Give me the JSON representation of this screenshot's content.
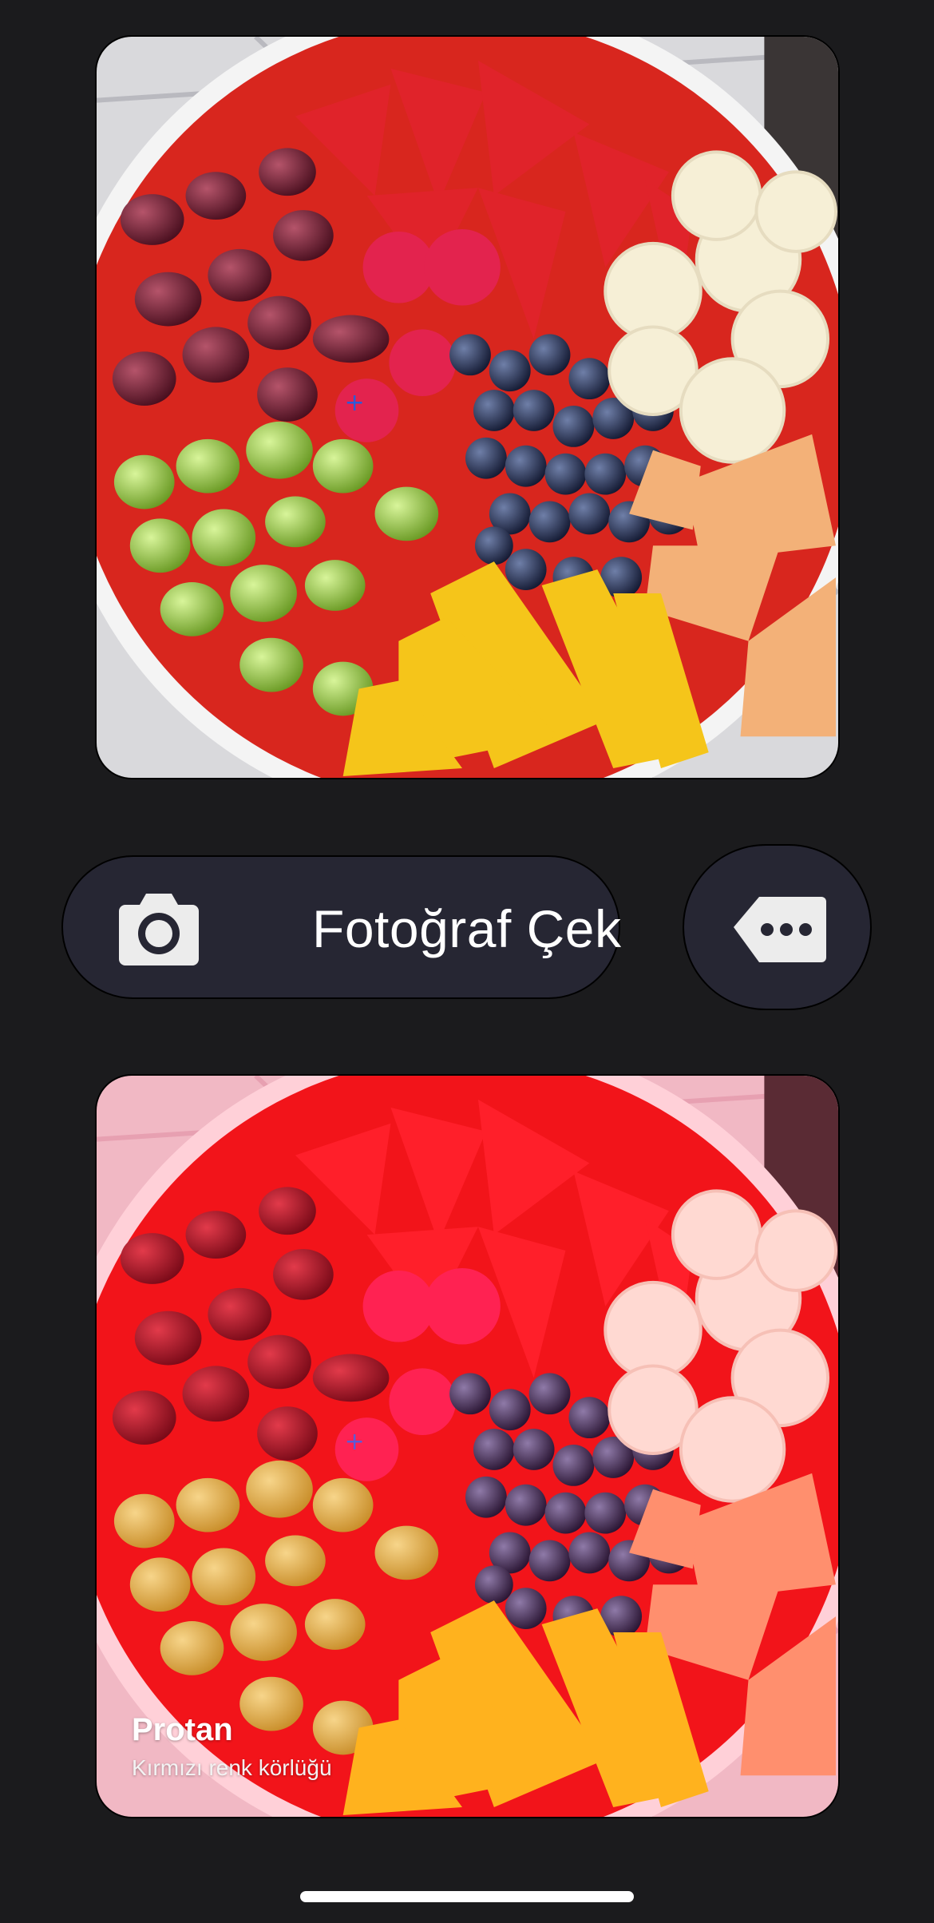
{
  "capture_button": {
    "label": "Fotoğraf Çek",
    "icon": "camera-icon"
  },
  "more_button": {
    "icon": "tag-ellipsis-icon"
  },
  "preview": {
    "original_image": "fruit-bowl-photo",
    "filtered_image": "fruit-bowl-photo-protan-filter",
    "filter_name": "Protan",
    "filter_description": "Kırmızı renk körlüğü"
  },
  "colors": {
    "background": "#1b1b1d",
    "button_bg": "#262633",
    "icon_fill": "#ececec"
  }
}
